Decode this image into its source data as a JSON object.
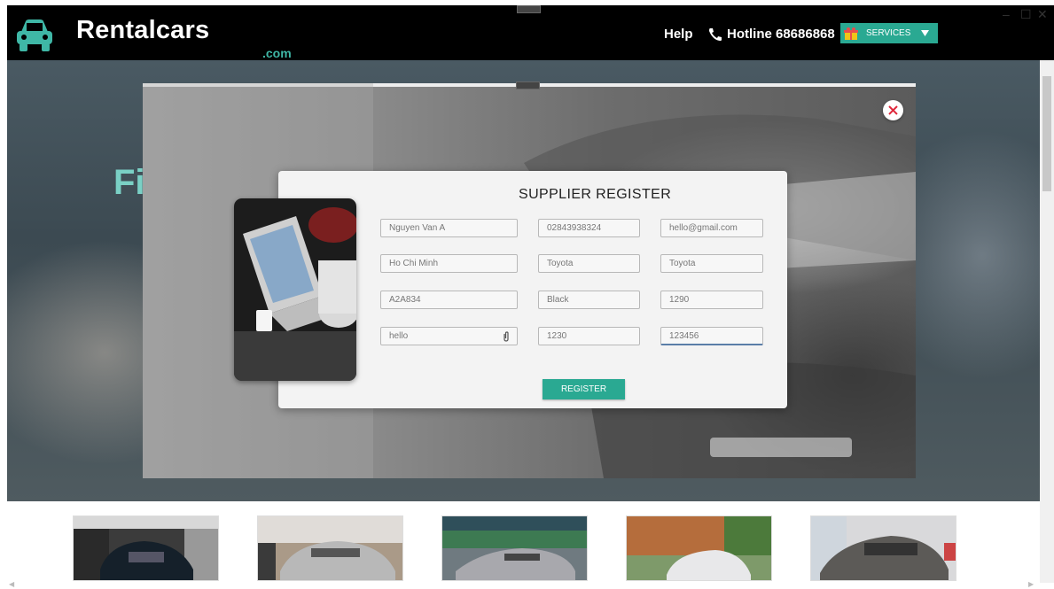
{
  "header": {
    "brand": "Rentalcars",
    "brand_suffix": ".com",
    "help": "Help",
    "hotline": "Hotline 68686868",
    "services_label": "SERVICES",
    "icons": {
      "logo": "car-icon",
      "phone": "phone-icon",
      "services": "gift-icon",
      "caret": "caret-down-icon"
    }
  },
  "window_controls": {
    "minimize": "–",
    "maximize": "☐",
    "close": "✕"
  },
  "hero": {
    "title_partial": "Fi"
  },
  "modal": {
    "title": "SUPPLIER REGISTER",
    "fields": [
      [
        "Nguyen Van A",
        "02843938324",
        "hello@gmail.com"
      ],
      [
        "Ho Chi Minh",
        "Toyota",
        "Toyota"
      ],
      [
        "A2A834",
        "Black",
        "1290"
      ],
      [
        "hello",
        "1230",
        "123456"
      ]
    ],
    "register_label": "REGISTER"
  },
  "thumbnails": [
    {
      "name": "car-thumb-mazda-black"
    },
    {
      "name": "car-thumb-toyota-silver-suv"
    },
    {
      "name": "car-thumb-toyota-vios-silver"
    },
    {
      "name": "car-thumb-toyota-innova"
    },
    {
      "name": "car-thumb-toyota-rush"
    }
  ],
  "colors": {
    "accent": "#2aa992",
    "brand_suffix": "#3fb7a6",
    "close_icon": "#e0283c"
  }
}
